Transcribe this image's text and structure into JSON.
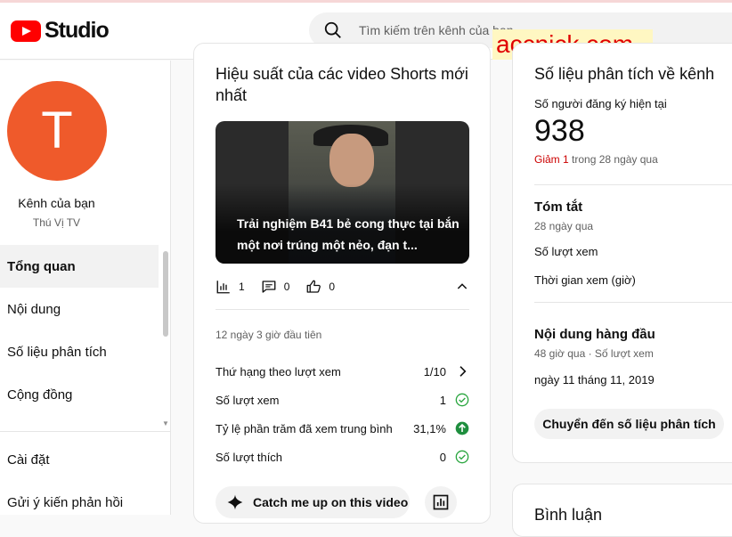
{
  "header": {
    "brand": "Studio",
    "search_placeholder": "Tìm kiếm trên kênh của bạn",
    "watermark": "accnick.com"
  },
  "sidebar": {
    "avatar_letter": "T",
    "channel_label": "Kênh của bạn",
    "channel_name": "Thú Vị TV",
    "items": [
      {
        "label": "Tổng quan"
      },
      {
        "label": "Nội dung"
      },
      {
        "label": "Số liệu phân tích"
      },
      {
        "label": "Cộng đồng"
      }
    ],
    "bottom_items": [
      {
        "label": "Cài đặt"
      },
      {
        "label": "Gửi ý kiến phản hồi"
      }
    ]
  },
  "shorts_card": {
    "title": "Hiệu suất của các video Shorts mới nhất",
    "video_title": "Trải nghiệm B41 bẻ cong thực tại bắn một nơi trúng một nẻo, đạn t...",
    "views": "1",
    "comments": "0",
    "likes": "0",
    "first_period": "12 ngày 3 giờ đầu tiên",
    "rows": [
      {
        "label": "Thứ hạng theo lượt xem",
        "value": "1/10",
        "icon": "chevron-right-icon"
      },
      {
        "label": "Số lượt xem",
        "value": "1",
        "icon": "check-circle-icon"
      },
      {
        "label": "Tỷ lệ phần trăm đã xem trung bình",
        "value": "31,1%",
        "icon": "arrow-up-circle-icon"
      },
      {
        "label": "Số lượt thích",
        "value": "0",
        "icon": "check-circle-icon"
      }
    ],
    "catch_up_label": "Catch me up on this video"
  },
  "analytics_card": {
    "title": "Số liệu phân tích về kênh",
    "subs_label": "Số người đăng ký hiện tại",
    "subs_value": "938",
    "decrease_label": "Giảm 1",
    "decrease_period": "trong 28 ngày qua",
    "summary_title": "Tóm tắt",
    "summary_period": "28 ngày qua",
    "metric_views": "Số lượt xem",
    "metric_watch": "Thời gian xem (giờ)",
    "top_title": "Nội dung hàng đầu",
    "top_sub": "48 giờ qua · Số lượt xem",
    "date": "ngày 11 tháng 11, 2019",
    "go_button": "Chuyển đến số liệu phân tích"
  },
  "comments_card": {
    "title": "Bình luận"
  },
  "colors": {
    "accent_red": "#ff0000",
    "avatar": "#ef5a2b",
    "decrease_red": "#cc0000",
    "check_green": "#2ba640",
    "up_green": "#1e8e3e"
  }
}
